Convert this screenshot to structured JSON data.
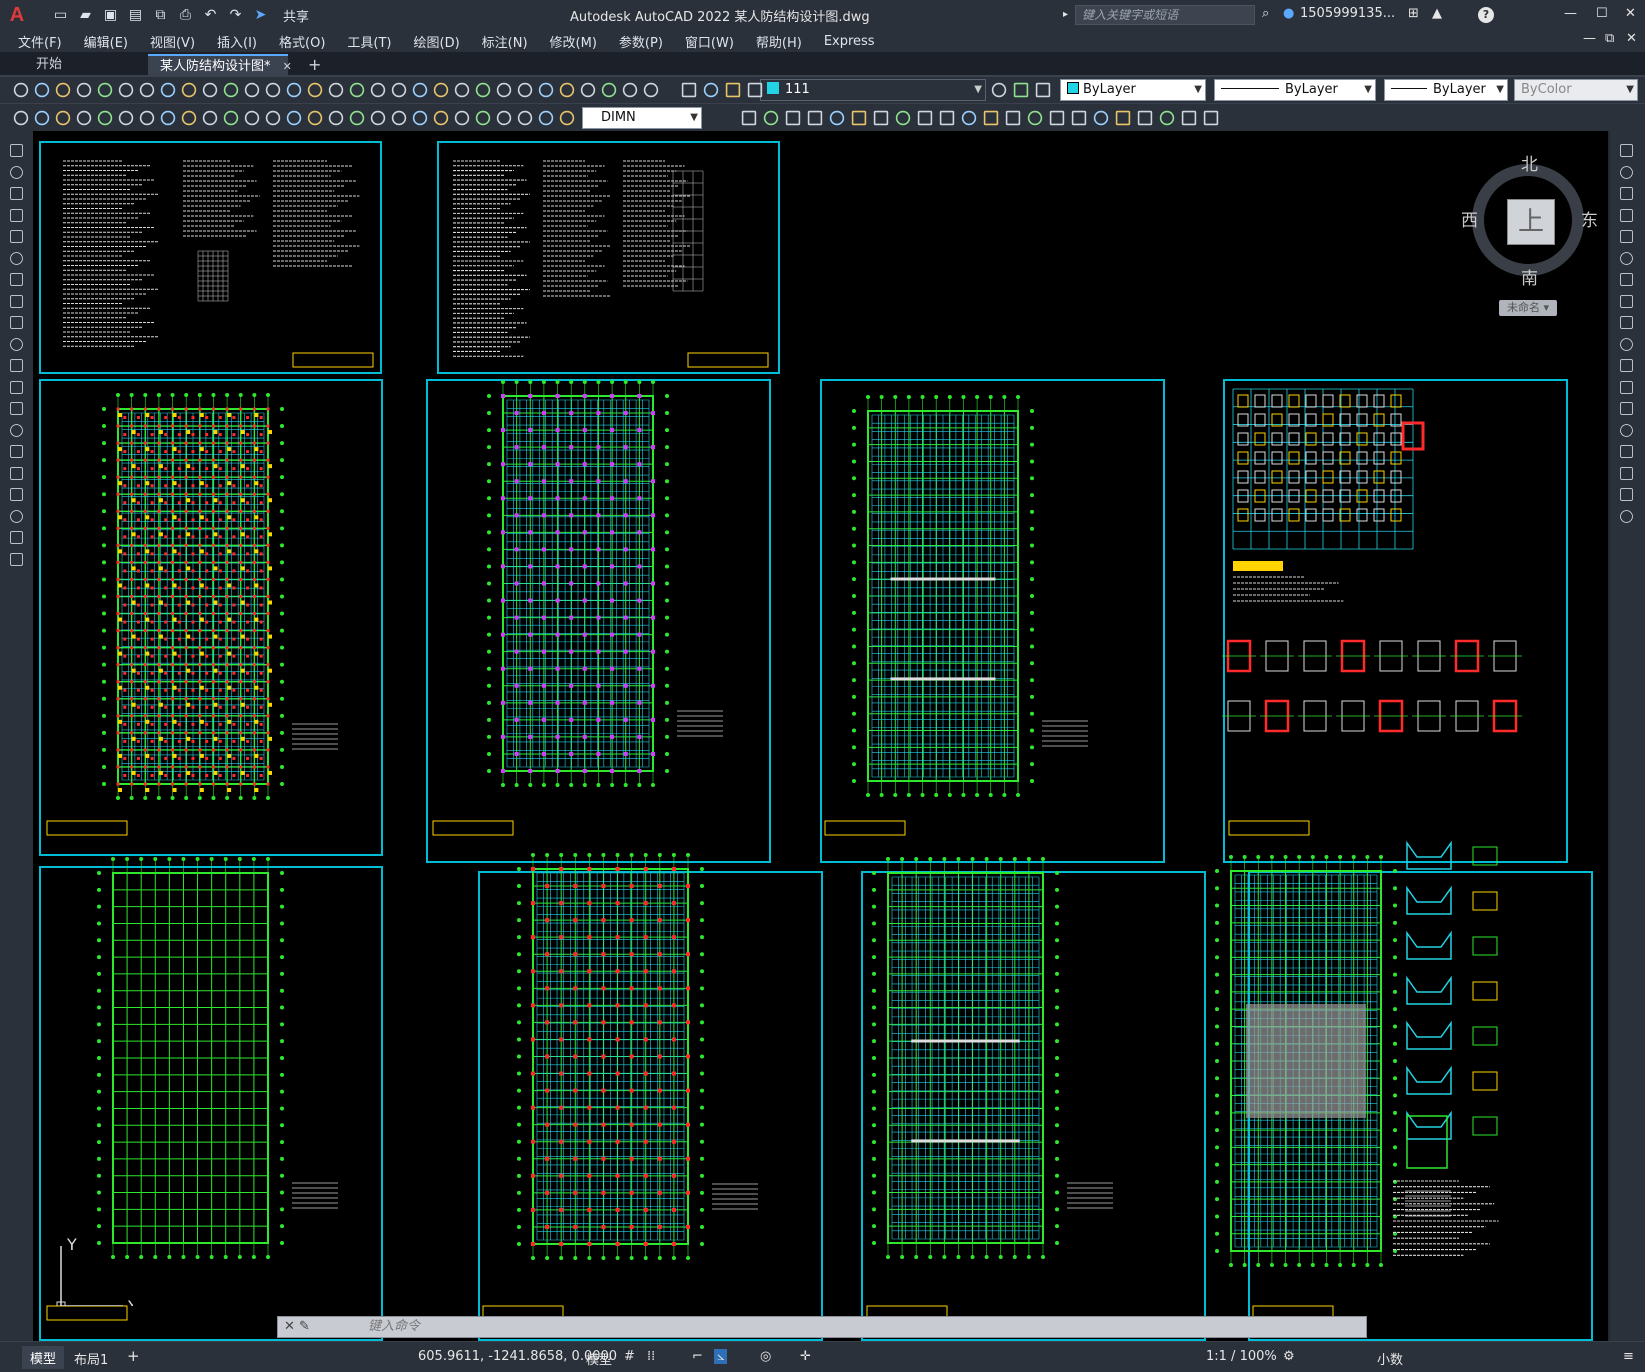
{
  "app": {
    "logo": "A",
    "share_label": "共享",
    "title": "Autodesk AutoCAD 2022    某人防结构设计图.dwg",
    "search_placeholder": "键入关键字或短语",
    "user": "1505999135...",
    "help": "?"
  },
  "menu": [
    "文件(F)",
    "编辑(E)",
    "视图(V)",
    "插入(I)",
    "格式(O)",
    "工具(T)",
    "绘图(D)",
    "标注(N)",
    "修改(M)",
    "参数(P)",
    "窗口(W)",
    "帮助(H)",
    "Express"
  ],
  "tabs": {
    "start": "开始",
    "active": "某人防结构设计图*",
    "close": "✕",
    "add": "+"
  },
  "toolbar": {
    "layer": "111",
    "dimstyle": "DIMN",
    "color": "ByLayer",
    "linetype": "ByLayer",
    "lineweight": "ByLayer",
    "plotstyle": "ByColor"
  },
  "viewcube": {
    "north": "北",
    "south": "南",
    "east": "东",
    "west": "西",
    "face": "上",
    "wcs": "未命名"
  },
  "command": {
    "placeholder": "键入命令"
  },
  "ucs": {
    "y": "Y",
    "x": "X"
  },
  "status": {
    "tab_model": "模型",
    "tab_layout": "布局1",
    "add": "+",
    "coords": "605.9611, -1241.8658, 0.0000",
    "space": "模型",
    "scale": "1:1 / 100%",
    "units": "小数"
  },
  "colors": {
    "sheet_border": "#00bcd4",
    "grid_green": "#2ee82e",
    "beam_cyan": "#22d3e6",
    "column_red": "#ff2a2a",
    "accent_yellow": "#ffd400"
  }
}
